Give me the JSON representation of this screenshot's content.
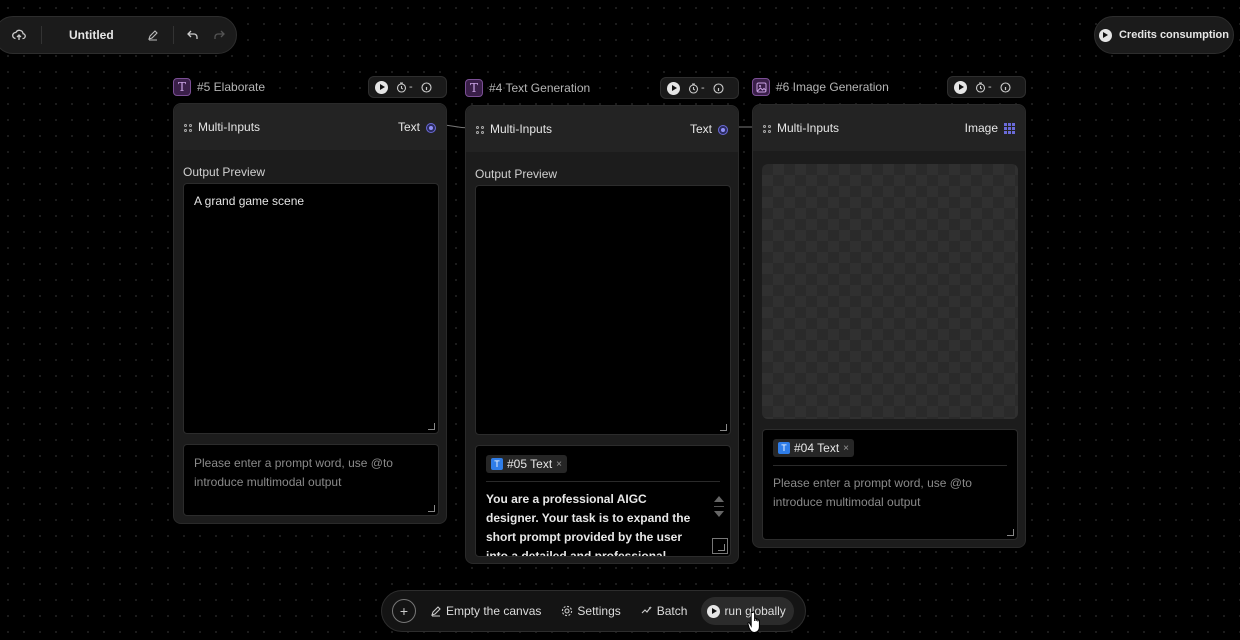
{
  "topbar": {
    "title": "Untitled"
  },
  "credits": {
    "label": "Credits consumption"
  },
  "nodes": [
    {
      "header": "#5 Elaborate",
      "tools_value": "-",
      "inputs_label": "Multi-Inputs",
      "output_type": "Text",
      "preview_label": "Output Preview",
      "preview_text": "A grand game scene",
      "prompt_placeholder": "Please enter a prompt word, use @to introduce multimodal output"
    },
    {
      "header": "#4 Text Generation",
      "tools_value": "-",
      "inputs_label": "Multi-Inputs",
      "output_type": "Text",
      "preview_label": "Output Preview",
      "preview_text": "",
      "chip": "#05 Text",
      "prompt_text": "You are a professional AIGC designer. Your task is to expand the short prompt provided by the user into a detailed and professional prompt in English."
    },
    {
      "header": "#6 Image Generation",
      "tools_value": "-",
      "inputs_label": "Multi-Inputs",
      "output_type": "Image",
      "chip": "#04 Text",
      "prompt_placeholder": "Please enter a prompt word, use @to introduce multimodal output"
    }
  ],
  "bottombar": {
    "empty_label": "Empty the canvas",
    "settings_label": "Settings",
    "batch_label": "Batch",
    "run_label": "run globally"
  },
  "colors": {
    "accent_port": "#8f8ff5",
    "chip_icon": "#2f7de8",
    "node_badge": "#c9a2e3"
  }
}
